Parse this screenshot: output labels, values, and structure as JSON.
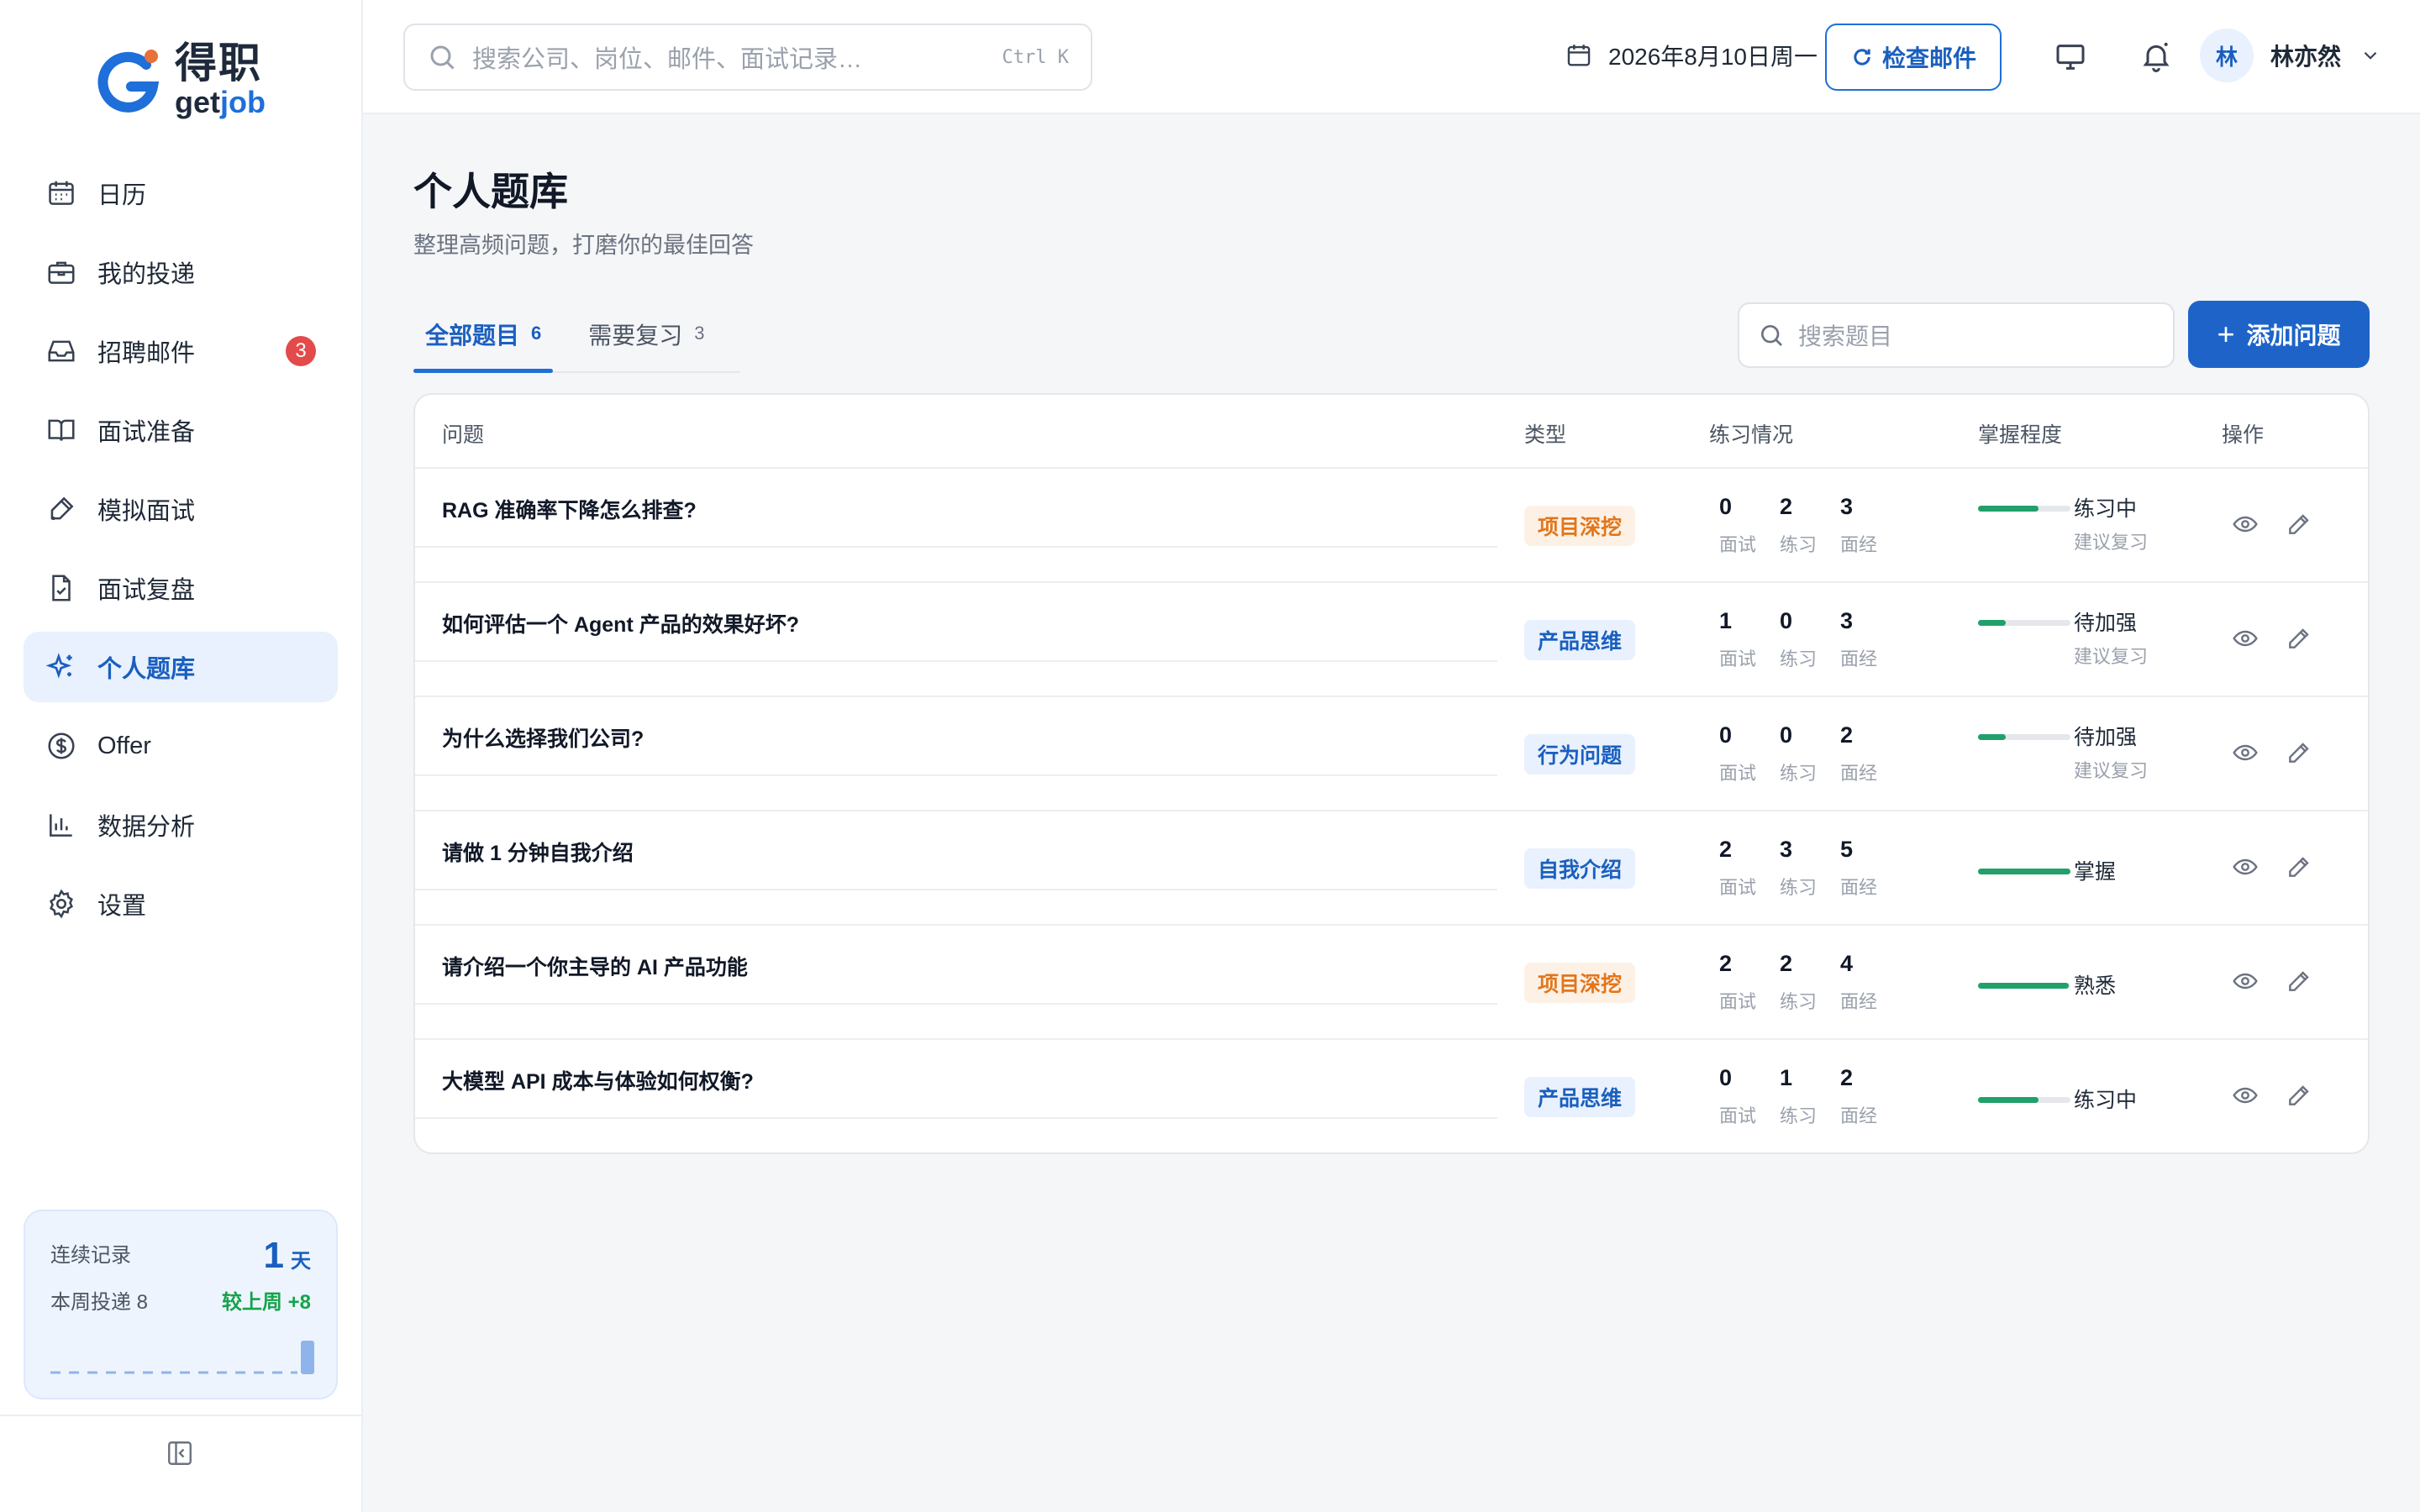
{
  "app": {
    "logo_cn": "得职",
    "logo_en_prefix": "get",
    "logo_en_suffix": "job",
    "brand_color": "#1e6fd9",
    "accent_color": "#e8703a"
  },
  "sidebar": {
    "items": [
      {
        "label": "日历",
        "icon": "calendar-icon"
      },
      {
        "label": "我的投递",
        "icon": "briefcase-icon"
      },
      {
        "label": "招聘邮件",
        "icon": "inbox-icon",
        "badge": "3"
      },
      {
        "label": "面试准备",
        "icon": "book-open-icon"
      },
      {
        "label": "模拟面试",
        "icon": "pen-icon"
      },
      {
        "label": "面试复盘",
        "icon": "file-check-icon"
      },
      {
        "label": "个人题库",
        "icon": "sparkles-icon",
        "active": true
      },
      {
        "label": "Offer",
        "icon": "dollar-circle-icon"
      },
      {
        "label": "数据分析",
        "icon": "bar-chart-icon"
      },
      {
        "label": "设置",
        "icon": "gear-icon"
      }
    ],
    "streak": {
      "label": "连续记录",
      "days": "1",
      "unit": "天",
      "week_label": "本周投递 8",
      "delta": "较上周 +8"
    }
  },
  "topbar": {
    "search_placeholder": "搜索公司、岗位、邮件、面试记录…",
    "search_shortcut": "Ctrl K",
    "date": "2026年8月10日周一",
    "check_mail": "检查邮件",
    "user_initial": "林",
    "user_name": "林亦然"
  },
  "main": {
    "title": "个人题库",
    "subtitle": "整理高频问题，打磨你的最佳回答",
    "tabs": [
      {
        "label": "全部题目",
        "count": "6",
        "active": true
      },
      {
        "label": "需要复习",
        "count": "3"
      }
    ],
    "search_placeholder": "搜索题目",
    "add_button": "添加问题",
    "columns": [
      "问题",
      "类型",
      "练习情况",
      "掌握程度",
      "操作"
    ],
    "stat_labels": [
      "面试",
      "练习",
      "面经"
    ],
    "rows": [
      {
        "question": "RAG 准确率下降怎么排查?",
        "type": "项目深挖",
        "type_color": "orange",
        "interview": "0",
        "practice": "2",
        "experience": "3",
        "mastery": "练习中",
        "mastery_level": 0.65,
        "note": "建议复习"
      },
      {
        "question": "如何评估一个 Agent 产品的效果好坏?",
        "type": "产品思维",
        "type_color": "blue",
        "interview": "1",
        "practice": "0",
        "experience": "3",
        "mastery": "待加强",
        "mastery_level": 0.3,
        "note": "建议复习"
      },
      {
        "question": "为什么选择我们公司?",
        "type": "行为问题",
        "type_color": "blue",
        "interview": "0",
        "practice": "0",
        "experience": "2",
        "mastery": "待加强",
        "mastery_level": 0.3,
        "note": "建议复习"
      },
      {
        "question": "请做 1 分钟自我介绍",
        "type": "自我介绍",
        "type_color": "blue",
        "interview": "2",
        "practice": "3",
        "experience": "5",
        "mastery": "掌握",
        "mastery_level": 1.0,
        "note": ""
      },
      {
        "question": "请介绍一个你主导的 AI 产品功能",
        "type": "项目深挖",
        "type_color": "orange",
        "interview": "2",
        "practice": "2",
        "experience": "4",
        "mastery": "熟悉",
        "mastery_level": 0.98,
        "note": ""
      },
      {
        "question": "大模型 API 成本与体验如何权衡?",
        "type": "产品思维",
        "type_color": "blue",
        "interview": "0",
        "practice": "1",
        "experience": "2",
        "mastery": "练习中",
        "mastery_level": 0.65,
        "note": ""
      }
    ]
  }
}
